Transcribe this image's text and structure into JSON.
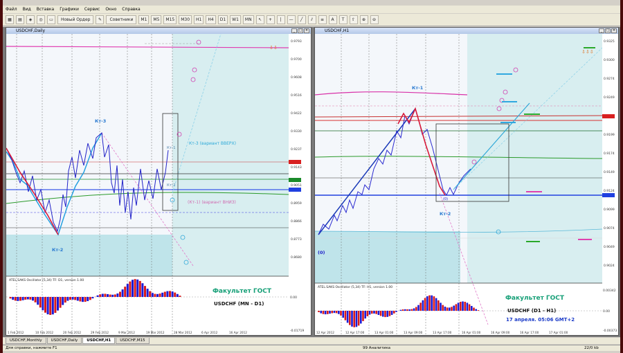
{
  "menu": [
    "Файл",
    "Вид",
    "Вставка",
    "Графики",
    "Сервис",
    "Окно",
    "Справка"
  ],
  "toolbar": {
    "new_order": "Новый Ордер",
    "advisors": "Советники",
    "periods": [
      "M1",
      "M5",
      "M15",
      "M30",
      "H1",
      "H4",
      "D1",
      "W1",
      "MN"
    ]
  },
  "left_chart": {
    "title": "USDCHF,Daily",
    "oscillator_label": "ATEL.SAKS Oscillator (5,34) TF: D1, version 1.00",
    "caption1": "Факультет ГОСТ",
    "caption2": "USDCHF (MN - D1)",
    "labels": {
      "kt3": "Кт-3",
      "kt2": "Кт-2",
      "kt1": "Кт-1",
      "kt2b": "Кт-2",
      "variant_up": "Кт-3 (вариант ВВЕРХ)",
      "variant_down": "(Кт-1) (вариант ВНИЗ)"
    },
    "prices": [
      "0.9793",
      "0.9700",
      "0.9608",
      "0.9516",
      "0.9422",
      "0.9330",
      "0.9237",
      "0.9143",
      "0.9051",
      "0.8959",
      "0.8866",
      "0.8773",
      "0.8680"
    ],
    "osc_scale": [
      "0.00",
      "-0.01719"
    ],
    "x_labels": [
      "1 Feb 2012",
      "10 Feb 2012",
      "20 Feb 2012",
      "29 Feb 2012",
      "9 Mar 2012",
      "19 Mar 2012",
      "28 Mar 2012",
      "6 Apr 2012",
      "16 Apr 2012"
    ]
  },
  "right_chart": {
    "title": "USDCHF,H1",
    "oscillator_label": "ATEL.SAKS Oscillator (5,34) TF: H1, version 1.00",
    "caption1": "Факультет ГОСТ",
    "caption2": "USDCHF (D1 - H1)",
    "caption3": "17 апреля. 05:06 GMT+2",
    "labels": {
      "kt1": "Кт-1",
      "kt2": "Кт-2",
      "zero": "(0)",
      "zero2": "(0)"
    },
    "prices": [
      "0.9325",
      "0.9300",
      "0.9274",
      "0.9249",
      "0.9224",
      "0.9199",
      "0.9174",
      "0.9149",
      "0.9124",
      "0.9099",
      "0.9074",
      "0.9049",
      "0.9024"
    ],
    "osc_scale": [
      "0.00342",
      "0.00",
      "-0.00373"
    ],
    "x_labels": [
      "12 Apr 2012",
      "12 Apr 17:00",
      "13 Apr 01:00",
      "13 Apr 09:00",
      "13 Apr 17:00",
      "16 Apr 01:00",
      "16 Apr 09:00",
      "16 Apr 17:00",
      "17 Apr 01:00"
    ]
  },
  "tabs": [
    "USDCHF,Monthly",
    "USDCHF,Daily",
    "USDCHF,H1",
    "USDCHF,M15"
  ],
  "status": {
    "help": "Для справки, нажмите F1",
    "profile": "99 Аналитика",
    "traffic": "22/0 kb"
  },
  "colors": {
    "bull": "#1a1ad8",
    "bear": "#d81a3a",
    "teal_zone": "#bfe6ea",
    "magenta": "#e020c0",
    "cyan": "#20a8e0"
  }
}
